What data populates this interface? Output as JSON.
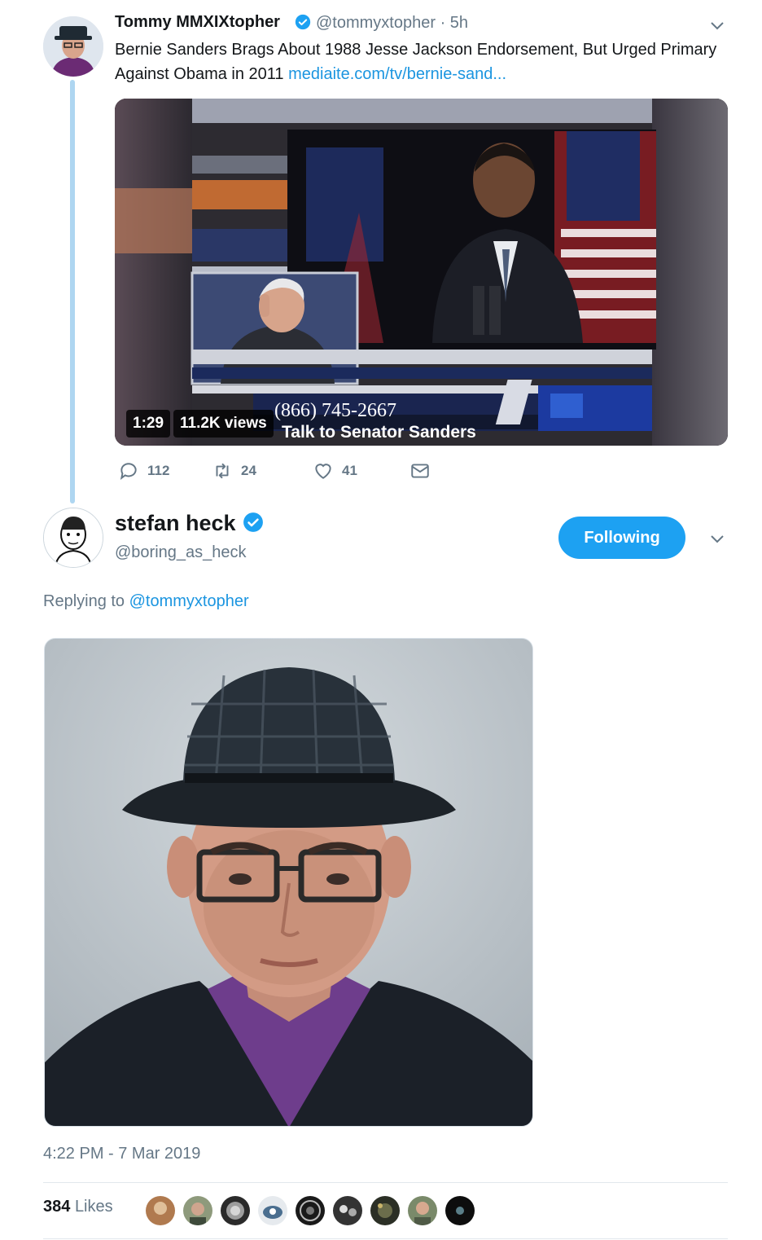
{
  "top_tweet": {
    "author_name": "Tommy MMXIXtopher",
    "handle_time": "@tommyxtopher · 5h",
    "text": "Bernie Sanders Brags About 1988 Jesse Jackson Endorsement, But Urged Primary Against Obama in 2011 ",
    "link": "mediaite.com/tv/bernie-sand...",
    "video": {
      "duration": "1:29",
      "views": "11.2K views",
      "overlay_phone": "(866) 745-2667",
      "overlay_caption": "Talk to Senator Sanders"
    },
    "actions": {
      "replies": "112",
      "retweets": "24",
      "likes": "41"
    }
  },
  "main_tweet": {
    "author_name": "stefan heck",
    "handle": "@boring_as_heck",
    "follow_label": "Following",
    "replying_prefix": "Replying to ",
    "replying_handle": "@tommyxtopher",
    "timestamp": "4:22 PM - 7 Mar 2019",
    "likes_count": "384",
    "likes_label": "Likes"
  },
  "colors": {
    "accent": "#1da1f2",
    "link": "#1b95e0",
    "muted": "#657786",
    "thread_line": "#aed6f1"
  },
  "icons": [
    "verified-badge-icon",
    "chevron-down-icon",
    "reply-icon",
    "retweet-icon",
    "like-icon",
    "direct-message-icon"
  ]
}
